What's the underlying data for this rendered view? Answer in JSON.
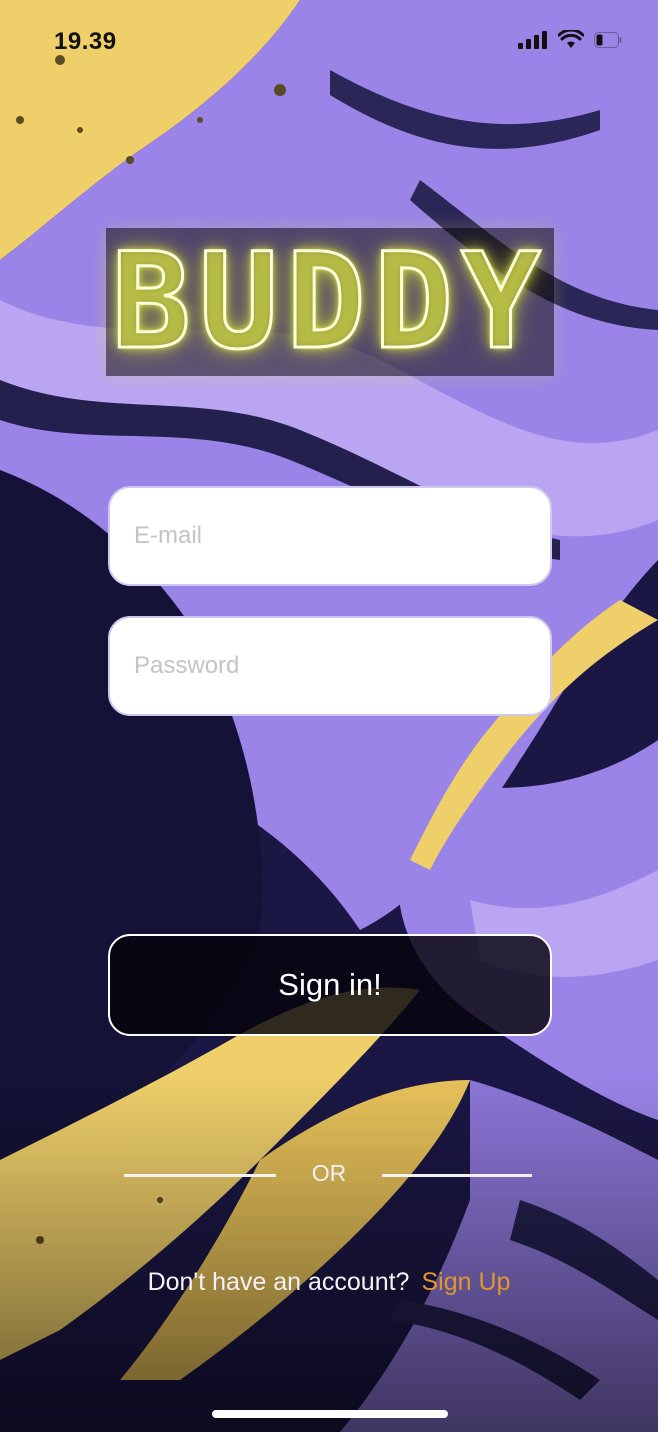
{
  "status_bar": {
    "time": "19.39",
    "signal_icon": "cellular-signal-icon",
    "wifi_icon": "wifi-icon",
    "battery_icon": "battery-icon"
  },
  "logo": {
    "text": "BUDDY"
  },
  "form": {
    "email_placeholder": "E-mail",
    "password_placeholder": "Password",
    "signin_label": "Sign in!"
  },
  "divider": {
    "label": "OR"
  },
  "signup": {
    "prompt": "Don't have an account?",
    "link_label": "Sign Up"
  },
  "colors": {
    "accent_link": "#e1962c",
    "logo_glow": "#e8ef5a",
    "background_dark": "#1b1745",
    "background_purple": "#9a84e8",
    "background_yellow": "#efcf6a"
  }
}
